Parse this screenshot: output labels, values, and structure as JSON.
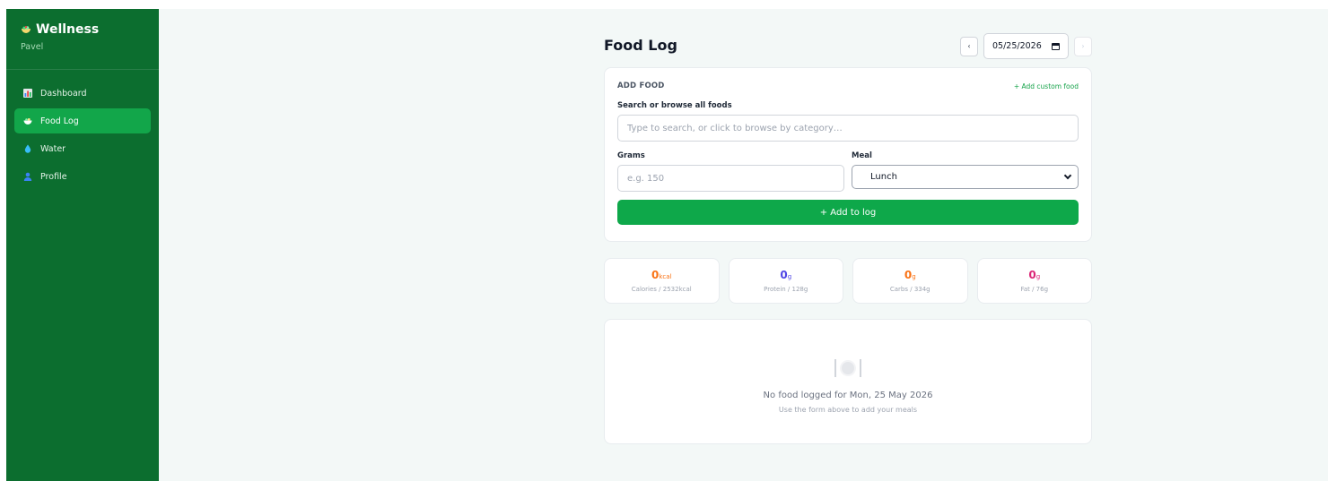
{
  "sidebar": {
    "brand": "Wellness",
    "user": "Pavel",
    "items": [
      {
        "label": "Dashboard",
        "icon": "bar-chart-icon",
        "active": false
      },
      {
        "label": "Food Log",
        "icon": "bowl-icon",
        "active": true
      },
      {
        "label": "Water",
        "icon": "water-drop-icon",
        "active": false
      },
      {
        "label": "Profile",
        "icon": "person-icon",
        "active": false
      }
    ]
  },
  "header": {
    "title": "Food Log",
    "date_value": "05/25/2026",
    "prev_label": "‹",
    "next_label": "›"
  },
  "add_food": {
    "section_title": "ADD FOOD",
    "custom_link": "+ Add custom food",
    "search_label": "Search or browse all foods",
    "search_placeholder": "Type to search, or click to browse by category…",
    "grams_label": "Grams",
    "grams_placeholder": "e.g. 150",
    "meal_label": "Meal",
    "meal_value": "Lunch",
    "submit_label": "+ Add to log"
  },
  "stats": [
    {
      "value": "0",
      "unit": "kcal",
      "label": "Calories / 2532kcal",
      "color": "#f97316"
    },
    {
      "value": "0",
      "unit": "g",
      "label": "Protein / 128g",
      "color": "#4f46e5"
    },
    {
      "value": "0",
      "unit": "g",
      "label": "Carbs / 334g",
      "color": "#f97316"
    },
    {
      "value": "0",
      "unit": "g",
      "label": "Fat / 76g",
      "color": "#db2777"
    }
  ],
  "empty_state": {
    "icon": "plate-cutlery-icon",
    "title": "No food logged for Mon, 25 May 2026",
    "subtitle": "Use the form above to add your meals"
  },
  "colors": {
    "sidebar_bg": "#0c6e2f",
    "accent": "#0ea84a",
    "page_bg": "#f3f8f7"
  }
}
